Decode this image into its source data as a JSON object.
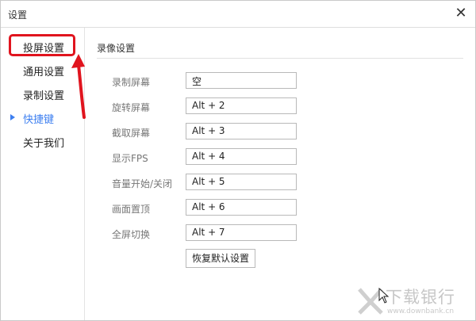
{
  "window": {
    "title": "设置"
  },
  "sidebar": {
    "items": [
      {
        "label": "投屏设置"
      },
      {
        "label": "通用设置"
      },
      {
        "label": "录制设置"
      },
      {
        "label": "快捷键",
        "active": true
      },
      {
        "label": "关于我们"
      }
    ]
  },
  "section": {
    "title": "录像设置",
    "rows": [
      {
        "label": "录制屏幕",
        "value": "空"
      },
      {
        "label": "旋转屏幕",
        "value": "Alt + 2"
      },
      {
        "label": "截取屏幕",
        "value": "Alt + 3"
      },
      {
        "label": "显示FPS",
        "value": "Alt + 4"
      },
      {
        "label": "音量开始/关闭",
        "value": "Alt + 5"
      },
      {
        "label": "画面置顶",
        "value": "Alt + 6"
      },
      {
        "label": "全屏切换",
        "value": "Alt + 7"
      }
    ],
    "reset_label": "恢复默认设置"
  },
  "watermark": {
    "text": "下载银行",
    "url": "www.downbank.cn"
  },
  "colors": {
    "accent": "#3d7ff0",
    "annotation": "#e0141e"
  }
}
